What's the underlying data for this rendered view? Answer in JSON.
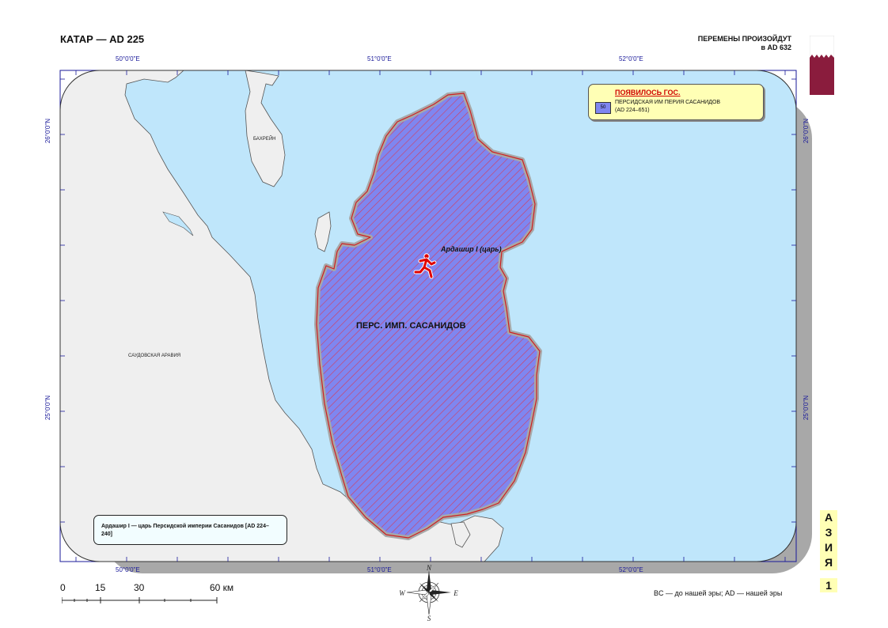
{
  "header": {
    "title": "КАТАР — AD 225",
    "changes_line1": "ПЕРЕМЕНЫ ПРОИЗОЙДУТ",
    "changes_line2": "в AD 632"
  },
  "coords": {
    "top": [
      "50°0'0\"E",
      "51°0'0\"E",
      "52°0'0\"E"
    ],
    "bottom": [
      "50°0'0\"E",
      "51°0'0\"E",
      "52°0'0\"E"
    ],
    "left": [
      "26°0'0\"N",
      "25°0'0\"N"
    ],
    "right": [
      "26°0'0\"N",
      "25°0'0\"N"
    ]
  },
  "places": {
    "bahrain": "БАХРЕЙН",
    "saudi": "САУДОВСКАЯ АРАВИЯ",
    "empire": "ПЕРС. ИМП. САСАНИДОВ",
    "ruler": "Ардашир I (царь)"
  },
  "legend": {
    "heading": "ПОЯВИЛОСЬ ГОС.",
    "swatch_code": "50",
    "entry_line1": "ПЕРСИДСКАЯ ИМ ПЕРИЯ САСАНИДОВ",
    "entry_line2": "(AD 224–651)"
  },
  "note": {
    "text": "Ардашир I — царь Персидской империи Сасанидов [AD 224–240]"
  },
  "scale": {
    "labels": [
      "0",
      "15",
      "30",
      "60 км"
    ]
  },
  "side_tab": {
    "letters": [
      "А",
      "З",
      "И",
      "Я"
    ],
    "page": "1"
  },
  "footer": {
    "text": "BC — до нашей эры; AD — нашей эры"
  },
  "colors": {
    "sea": "#bfe6fb",
    "land": "#efefef",
    "empire_fill": "#7f86f0",
    "hatch": "#d33c5c",
    "border_halo": "#a8a8a8",
    "flag_maroon": "#8a1c3d",
    "legend_bg": "#ffffb5"
  }
}
